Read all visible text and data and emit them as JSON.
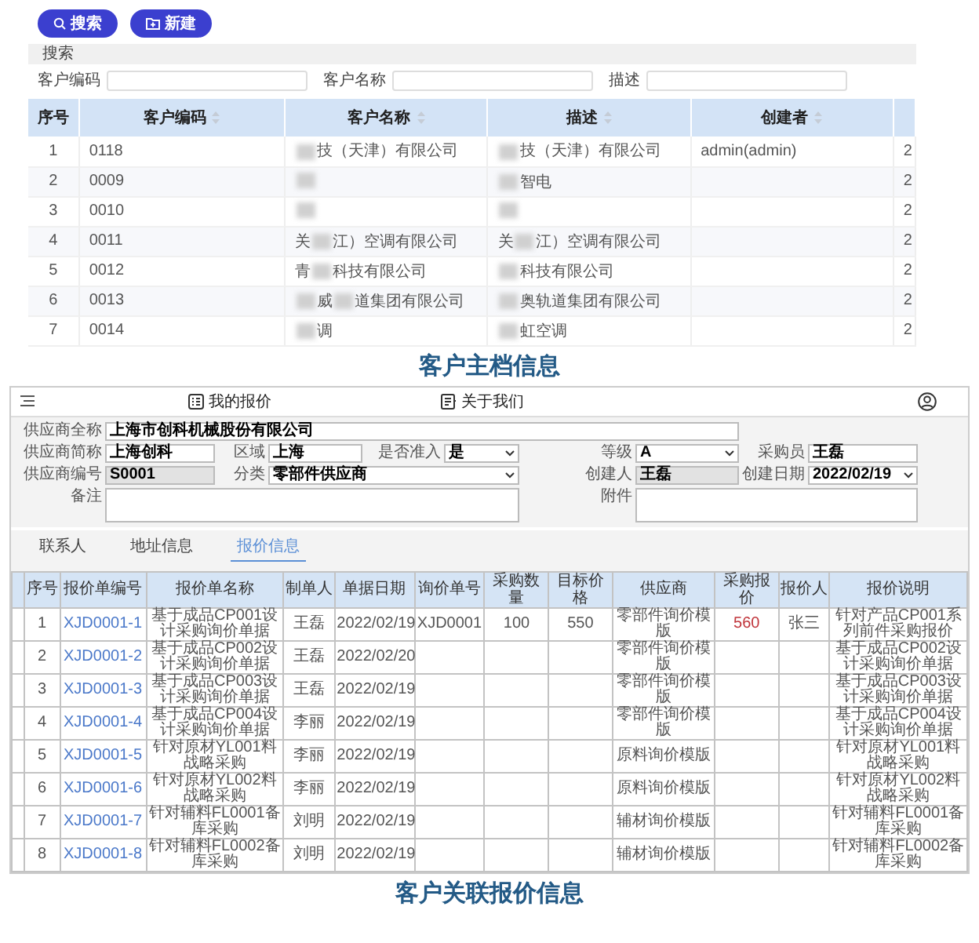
{
  "customer_master": {
    "buttons": [
      {
        "label": "搜索",
        "kind": "search"
      },
      {
        "label": "新建",
        "kind": "new"
      }
    ],
    "search_section": {
      "title": "搜索",
      "fields": [
        {
          "label": "客户编码"
        },
        {
          "label": "客户名称"
        },
        {
          "label": "描述"
        }
      ]
    },
    "table": {
      "columns": [
        {
          "label": "序号",
          "sortable": false
        },
        {
          "label": "客户编码",
          "sortable": true
        },
        {
          "label": "客户名称",
          "sortable": true
        },
        {
          "label": "描述",
          "sortable": true
        },
        {
          "label": "创建者",
          "sortable": true
        }
      ],
      "rows": [
        {
          "cells": [
            "1",
            "0118",
            [
              null,
              "技（天津）有限公司"
            ],
            [
              null,
              "技（天津）有限公司"
            ],
            "admin(admin)",
            "2"
          ]
        },
        {
          "cells": [
            "2",
            "0009",
            [
              null
            ],
            [
              null,
              "智电"
            ],
            null,
            "2"
          ]
        },
        {
          "cells": [
            "3",
            "0010",
            [
              null
            ],
            [
              null
            ],
            null,
            "2"
          ]
        },
        {
          "cells": [
            "4",
            "0011",
            [
              "关",
              null,
              "江）空调有限公司"
            ],
            [
              "关",
              null,
              "江）空调有限公司"
            ],
            null,
            "2"
          ]
        },
        {
          "cells": [
            "5",
            "0012",
            [
              "青",
              null,
              "科技有限公司"
            ],
            [
              null,
              "科技有限公司"
            ],
            null,
            "2"
          ]
        },
        {
          "cells": [
            "6",
            "0013",
            [
              null,
              "威",
              null,
              "道集团有限公司"
            ],
            [
              null,
              "奥轨道集团有限公司"
            ],
            null,
            "2"
          ]
        },
        {
          "cells": [
            "7",
            "0014",
            [
              null,
              "调"
            ],
            [
              null,
              "虹空调"
            ],
            null,
            "2"
          ]
        }
      ]
    }
  },
  "caption_1": "客户主档信息",
  "quote_app": {
    "nav": [
      {
        "label": "我的报价",
        "kind": "list"
      },
      {
        "label": "关于我们",
        "kind": "info"
      }
    ],
    "form": {
      "rows": [
        {
          "fields": [
            {
              "label": "供应商全称",
              "value": "上海市创科机械股份有限公司",
              "kind": "input"
            }
          ]
        },
        {
          "fields": [
            {
              "label": "供应商简称",
              "value": "上海创科",
              "kind": "input"
            },
            {
              "label": "区域",
              "value": "上海",
              "kind": "input"
            },
            {
              "label": "是否准入",
              "value": "是",
              "kind": "select"
            },
            {
              "label": "等级",
              "value": "A",
              "kind": "select"
            },
            {
              "label": "采购员",
              "value": "王磊",
              "kind": "input"
            }
          ]
        },
        {
          "fields": [
            {
              "label": "供应商编号",
              "value": "S0001",
              "kind": "readonly"
            },
            {
              "label": "分类",
              "value": "零部件供应商",
              "kind": "select"
            },
            {
              "label": "创建人",
              "value": "王磊",
              "kind": "readonly"
            },
            {
              "label": "创建日期",
              "value": "2022/02/19",
              "kind": "select"
            }
          ]
        },
        {
          "fields": [
            {
              "label": "备注",
              "kind": "textarea"
            },
            {
              "label": "附件",
              "kind": "textarea"
            }
          ]
        }
      ]
    },
    "tabs": [
      {
        "label": "联系人",
        "selected": false
      },
      {
        "label": "地址信息",
        "selected": false
      },
      {
        "label": "报价信息",
        "selected": true
      }
    ],
    "table": {
      "columns": [
        {
          "label": "序号",
          "kind": "text"
        },
        {
          "label": "报价单编号",
          "kind": "link"
        },
        {
          "label": "报价单名称",
          "kind": "text"
        },
        {
          "label": "制单人",
          "kind": "text"
        },
        {
          "label": "单据日期",
          "kind": "text"
        },
        {
          "label": "询价单号",
          "kind": "text"
        },
        {
          "label": "采购数量",
          "kind": "text"
        },
        {
          "label": "目标价格",
          "kind": "text"
        },
        {
          "label": "供应商",
          "kind": "text"
        },
        {
          "label": "采购报价",
          "kind": "price"
        },
        {
          "label": "报价人",
          "kind": "text"
        },
        {
          "label": "报价说明",
          "kind": "text"
        }
      ],
      "rows": [
        [
          "1",
          "XJD0001-1",
          "基于成品CP001设计采购询价单据",
          "王磊",
          "2022/02/19",
          "XJD0001",
          "100",
          "550",
          "零部件询价模版",
          "560",
          "张三",
          "针对产品CP001系列前件采购报价"
        ],
        [
          "2",
          "XJD0001-2",
          "基于成品CP002设计采购询价单据",
          "王磊",
          "2022/02/20",
          null,
          null,
          null,
          "零部件询价模版",
          null,
          null,
          "基于成品CP002设计采购询价单据"
        ],
        [
          "3",
          "XJD0001-3",
          "基于成品CP003设计采购询价单据",
          "王磊",
          "2022/02/19",
          null,
          null,
          null,
          "零部件询价模版",
          null,
          null,
          "基于成品CP003设计采购询价单据"
        ],
        [
          "4",
          "XJD0001-4",
          "基于成品CP004设计采购询价单据",
          "李丽",
          "2022/02/19",
          null,
          null,
          null,
          "零部件询价模版",
          null,
          null,
          "基于成品CP004设计采购询价单据"
        ],
        [
          "5",
          "XJD0001-5",
          "针对原材YL001料战略采购",
          "李丽",
          "2022/02/19",
          null,
          null,
          null,
          "原料询价模版",
          null,
          null,
          "针对原材YL001料战略采购"
        ],
        [
          "6",
          "XJD0001-6",
          "针对原材YL002料战略采购",
          "李丽",
          "2022/02/19",
          null,
          null,
          null,
          "原料询价模版",
          null,
          null,
          "针对原材YL002料战略采购"
        ],
        [
          "7",
          "XJD0001-7",
          "针对辅料FL0001备库采购",
          "刘明",
          "2022/02/19",
          null,
          null,
          null,
          "辅材询价模版",
          null,
          null,
          "针对辅料FL0001备库采购"
        ],
        [
          "8",
          "XJD0001-8",
          "针对辅料FL0002备库采购",
          "刘明",
          "2022/02/19",
          null,
          null,
          null,
          "辅材询价模版",
          null,
          null,
          "针对辅料FL0002备库采购"
        ]
      ]
    }
  },
  "caption_2": "客户关联报价信息"
}
